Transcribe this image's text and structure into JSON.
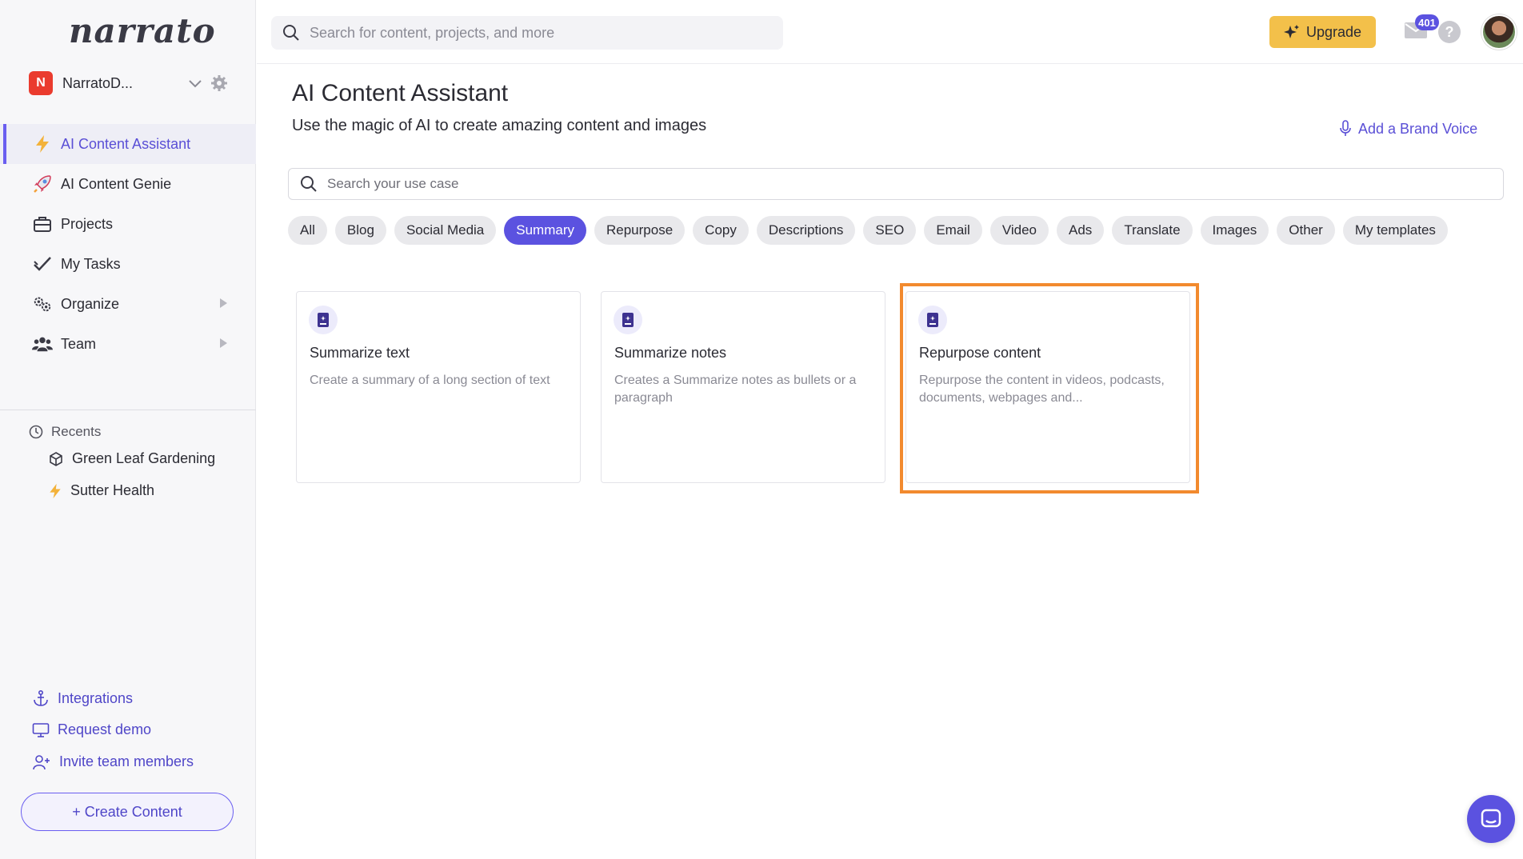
{
  "brand": {
    "logo_text": "narrato"
  },
  "workspace": {
    "badge": "N",
    "name": "NarratoD..."
  },
  "sidebar": {
    "items": [
      {
        "label": "AI Content Assistant",
        "icon": "lightning-icon",
        "active": true
      },
      {
        "label": "AI Content Genie",
        "icon": "rocket-icon"
      },
      {
        "label": "Projects",
        "icon": "briefcase-icon"
      },
      {
        "label": "My Tasks",
        "icon": "checkmark-icon"
      },
      {
        "label": "Organize",
        "icon": "gears-icon",
        "has_submenu": true
      },
      {
        "label": "Team",
        "icon": "team-icon",
        "has_submenu": true
      }
    ],
    "recents_title": "Recents",
    "recents": [
      {
        "label": "Green Leaf Gardening",
        "icon": "cube-icon"
      },
      {
        "label": "Sutter Health",
        "icon": "lightning-icon"
      }
    ],
    "bottom_links": [
      {
        "label": "Integrations",
        "icon": "anchor-icon"
      },
      {
        "label": "Request demo",
        "icon": "monitor-icon"
      },
      {
        "label": "Invite team members",
        "icon": "add-user-icon"
      }
    ],
    "create_button": "+ Create Content"
  },
  "topbar": {
    "search_placeholder": "Search for content, projects, and more",
    "upgrade_label": "Upgrade",
    "mail_count": "401",
    "help_label": "?"
  },
  "main": {
    "title": "AI Content Assistant",
    "subtitle": "Use the magic of AI to create amazing content and images",
    "brand_voice_label": "Add a Brand Voice",
    "usecase_search_placeholder": "Search your use case",
    "chips": [
      "All",
      "Blog",
      "Social Media",
      "Summary",
      "Repurpose",
      "Copy",
      "Descriptions",
      "SEO",
      "Email",
      "Video",
      "Ads",
      "Translate",
      "Images",
      "Other",
      "My templates"
    ],
    "active_chip": "Summary",
    "cards": [
      {
        "title": "Summarize text",
        "description": "Create a summary of a long section of text",
        "icon": "book-icon"
      },
      {
        "title": "Summarize notes",
        "description": "Creates a Summarize notes as bullets or a paragraph",
        "icon": "book-icon"
      },
      {
        "title": "Repurpose content",
        "description": "Repurpose the content in videos, podcasts, documents, webpages and...",
        "icon": "book-icon",
        "highlighted": true
      }
    ]
  },
  "colors": {
    "accent": "#5b52e0",
    "upgrade": "#f3c04a",
    "highlight": "#f28a2e",
    "workspace_badge": "#ea3b2e"
  }
}
